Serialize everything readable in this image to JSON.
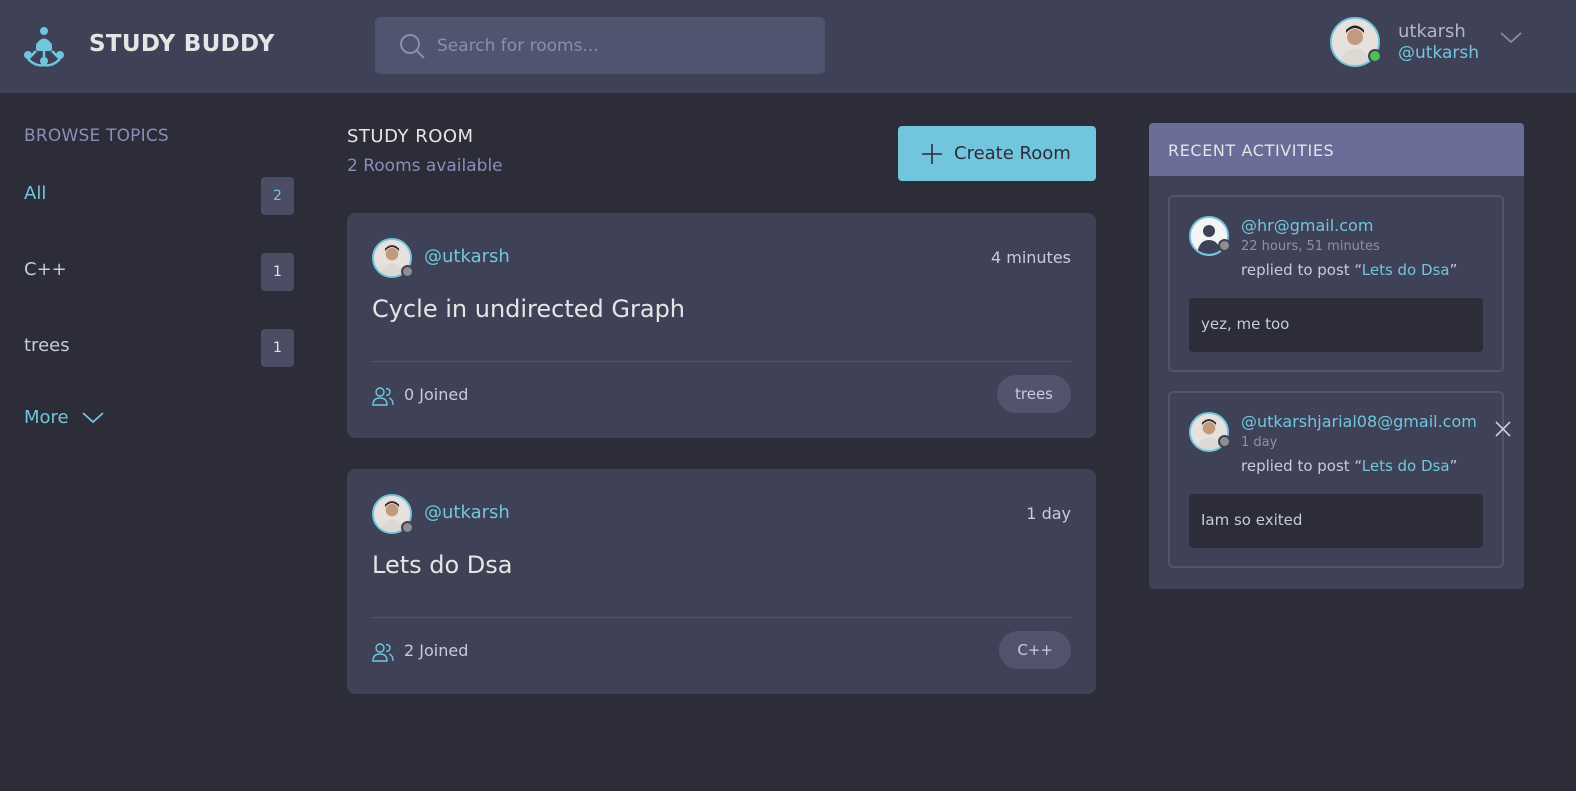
{
  "header": {
    "brand": "STUDY BUDDY",
    "search_placeholder": "Search for rooms...",
    "user": {
      "name": "utkarsh",
      "handle": "@utkarsh",
      "status_color": "#4cbf55"
    }
  },
  "sidebar": {
    "title": "BROWSE TOPICS",
    "topics": [
      {
        "label": "All",
        "count": "2",
        "active": true
      },
      {
        "label": "C++",
        "count": "1",
        "active": false
      },
      {
        "label": "trees",
        "count": "1",
        "active": false
      }
    ],
    "more_label": "More"
  },
  "main": {
    "title": "STUDY ROOM",
    "subtitle": "2 Rooms available",
    "create_label": "Create Room",
    "rooms": [
      {
        "host": "@utkarsh",
        "time": "4 minutes",
        "name": "Cycle in undirected Graph",
        "joined": "0 Joined",
        "topic": "trees"
      },
      {
        "host": "@utkarsh",
        "time": "1 day",
        "name": "Lets do Dsa",
        "joined": "2 Joined",
        "topic": "C++"
      }
    ]
  },
  "activities": {
    "title": "RECENT ACTIVITIES",
    "items": [
      {
        "user": "@hr@gmail.com",
        "time": "22 hours, 51 minutes",
        "prefix": "replied to post “",
        "post": "Lets do Dsa",
        "suffix": "”",
        "body": "yez, me too"
      },
      {
        "user": "@utkarshjarial08@gmail.com",
        "time": "1 day",
        "prefix": "replied to post “",
        "post": "Lets do Dsa",
        "suffix": "”",
        "body": "Iam so exited"
      }
    ]
  },
  "colors": {
    "accent": "#71c6dd",
    "background": "#2d2d39",
    "card": "#3f4156",
    "activity_header": "#696d97"
  }
}
